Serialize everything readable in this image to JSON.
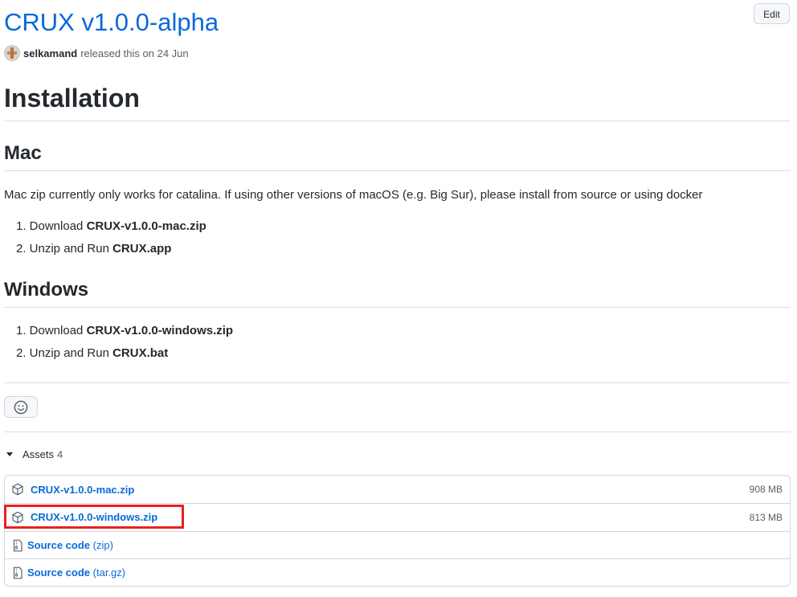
{
  "release": {
    "title": "CRUX v1.0.0-alpha",
    "edit_label": "Edit",
    "author": "selkamand",
    "released_text": "released this on 24 Jun"
  },
  "body": {
    "installation_heading": "Installation",
    "mac": {
      "heading": "Mac",
      "note": "Mac zip currently only works for catalina. If using other versions of macOS (e.g. Big Sur), please install from source or using docker",
      "steps": [
        {
          "prefix": "1. Download ",
          "bold": "CRUX-v1.0.0-mac.zip"
        },
        {
          "prefix": "2. Unzip and Run ",
          "bold": "CRUX.app"
        }
      ]
    },
    "windows": {
      "heading": "Windows",
      "steps": [
        {
          "prefix": "1. Download ",
          "bold": "CRUX-v1.0.0-windows.zip"
        },
        {
          "prefix": "2. Unzip and Run ",
          "bold": "CRUX.bat"
        }
      ]
    }
  },
  "reactions": {
    "icon": "smiley-icon"
  },
  "assets": {
    "label": "Assets",
    "count": "4",
    "items": [
      {
        "name": "CRUX-v1.0.0-mac.zip",
        "size": "908 MB",
        "icon": "package-icon"
      },
      {
        "name": "CRUX-v1.0.0-windows.zip",
        "size": "813 MB",
        "icon": "package-icon",
        "highlighted": true
      },
      {
        "name": "Source code",
        "suffix": "(zip)",
        "icon": "file-zip-icon"
      },
      {
        "name": "Source code",
        "suffix": "(tar.gz)",
        "icon": "file-zip-icon"
      }
    ],
    "highlight_color": "#e8211f"
  },
  "colors": {
    "link": "#0969da",
    "text": "#24292f",
    "muted": "#57606a",
    "border": "#d0d7de"
  }
}
